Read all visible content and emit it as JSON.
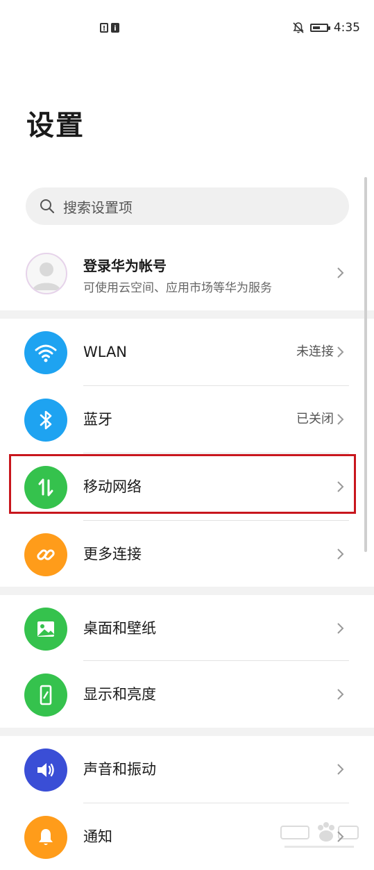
{
  "status_bar": {
    "time": "4:35",
    "left_icons": [
      "alert-icon",
      "info-icon"
    ],
    "right_icons": [
      "notification-off-icon",
      "battery-icon"
    ]
  },
  "page": {
    "title": "设置"
  },
  "search": {
    "placeholder": "搜索设置项"
  },
  "account": {
    "name": "登录华为帐号",
    "subtitle": "可使用云空间、应用市场等华为服务"
  },
  "groups": [
    {
      "items": [
        {
          "label": "WLAN",
          "status": "未连接",
          "icon": "wifi-icon",
          "color": "#1ea3f1"
        },
        {
          "label": "蓝牙",
          "status": "已关闭",
          "icon": "bluetooth-icon",
          "color": "#1ea3f1"
        },
        {
          "label": "移动网络",
          "status": "",
          "icon": "mobile-data-icon",
          "color": "#35c24d",
          "highlighted": true
        },
        {
          "label": "更多连接",
          "status": "",
          "icon": "link-icon",
          "color": "#ff9c1a"
        }
      ]
    },
    {
      "items": [
        {
          "label": "桌面和壁纸",
          "status": "",
          "icon": "image-icon",
          "color": "#35c24d"
        },
        {
          "label": "显示和亮度",
          "status": "",
          "icon": "phone-brightness-icon",
          "color": "#35c24d"
        }
      ]
    },
    {
      "items": [
        {
          "label": "声音和振动",
          "status": "",
          "icon": "speaker-icon",
          "color": "#3a4ed6"
        },
        {
          "label": "通知",
          "status": "",
          "icon": "bell-icon",
          "color": "#ff9c1a"
        }
      ]
    }
  ]
}
